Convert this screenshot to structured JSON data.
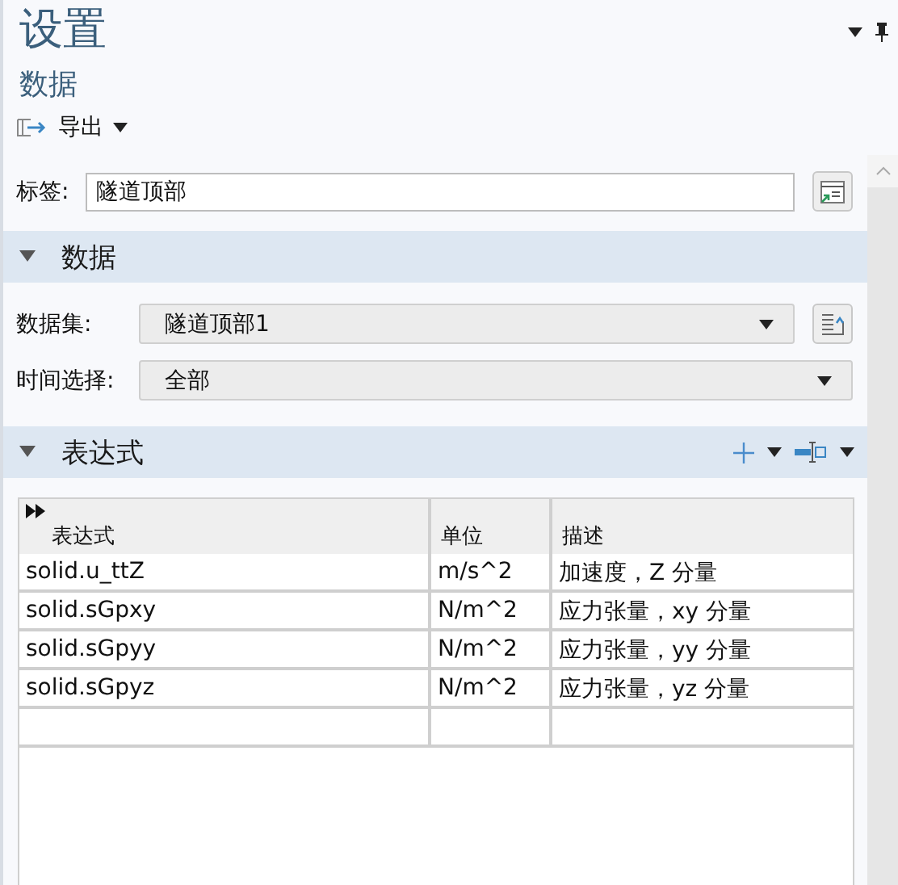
{
  "panel": {
    "title": "设置",
    "subtitle": "数据"
  },
  "toolbar": {
    "export": "导出"
  },
  "label_field": {
    "label": "标签:",
    "value": "隧道顶部"
  },
  "sections": [
    {
      "title": "数据",
      "expanded": true
    },
    {
      "title": "表达式",
      "expanded": true
    }
  ],
  "dataset": {
    "label": "数据集:",
    "value": "隧道顶部1"
  },
  "time_selection": {
    "label": "时间选择:",
    "value": "全部"
  },
  "table": {
    "columns": [
      "表达式",
      "单位",
      "描述"
    ],
    "rows": [
      [
        "solid.u_ttZ",
        "m/s^2",
        "加速度，Z 分量"
      ],
      [
        "solid.sGpxy",
        "N/m^2",
        "应力张量，xy 分量"
      ],
      [
        "solid.sGpyy",
        "N/m^2",
        "应力张量，yy 分量"
      ],
      [
        "solid.sGpyz",
        "N/m^2",
        "应力张量，yz 分量"
      ]
    ]
  }
}
